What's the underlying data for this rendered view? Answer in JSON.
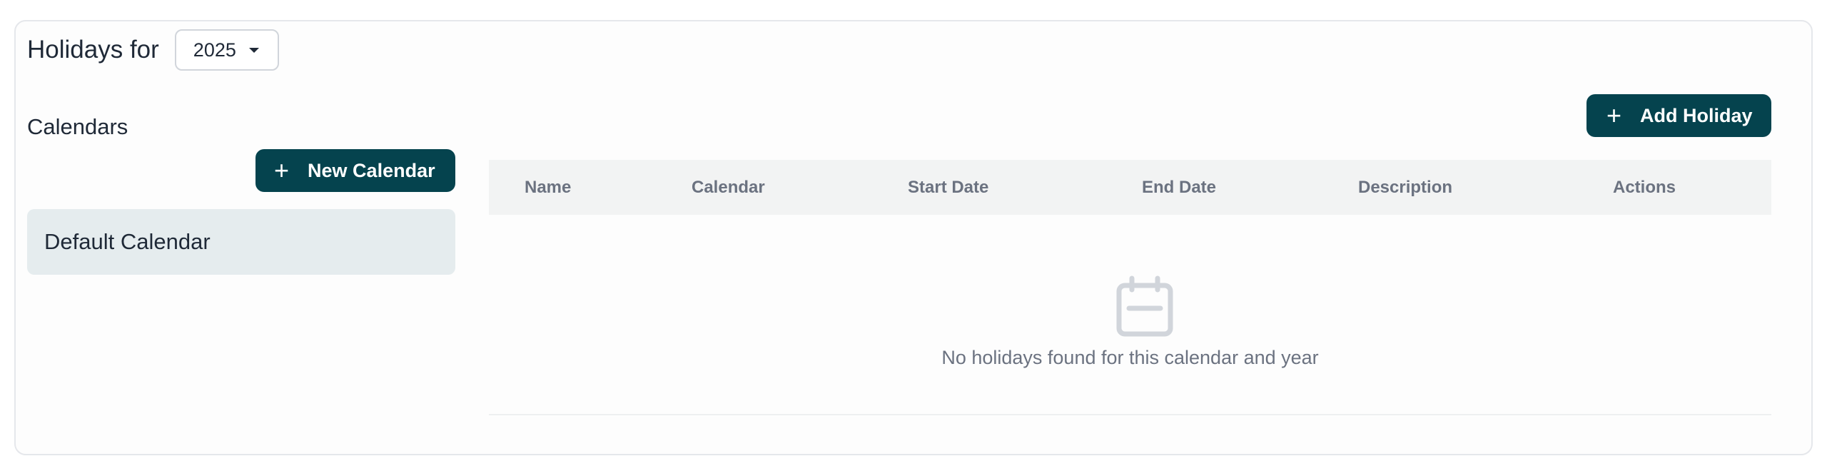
{
  "header": {
    "title": "Holidays for",
    "year_select": {
      "value": "2025"
    }
  },
  "sidebar": {
    "title": "Calendars",
    "new_calendar_label": "New Calendar",
    "calendars": [
      {
        "label": "Default Calendar",
        "selected": true
      }
    ]
  },
  "main": {
    "add_holiday_label": "Add Holiday",
    "table": {
      "columns": [
        "Name",
        "Calendar",
        "Start Date",
        "End Date",
        "Description",
        "Actions"
      ],
      "rows": [],
      "empty_message": "No holidays found for this calendar and year",
      "empty_icon": "calendar-icon"
    }
  },
  "colors": {
    "primary_button": "#05434e",
    "selected_item_bg": "#e5ecee",
    "table_header_bg": "#f2f3f3",
    "muted_text": "#6b7280"
  }
}
